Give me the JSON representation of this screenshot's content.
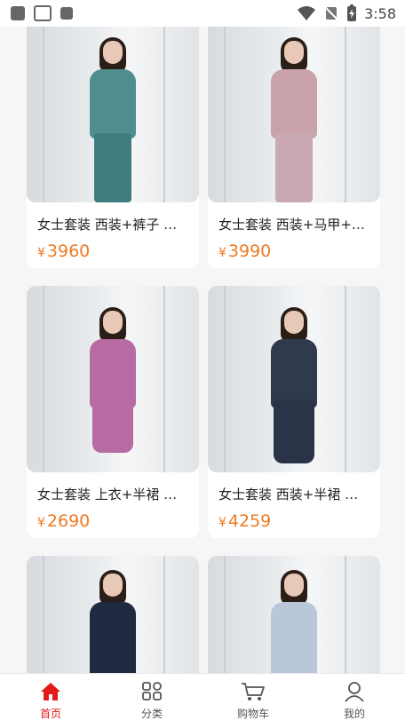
{
  "status_bar": {
    "time": "3:58",
    "icons": [
      "notification-icon",
      "mail-icon",
      "a-icon",
      "wifi-icon",
      "no-sim-icon",
      "battery-charging-icon"
    ]
  },
  "products": [
    {
      "title": "女士套装 西装+裤子 …",
      "currency": "¥",
      "price": "3960",
      "color": "#4f8e8e"
    },
    {
      "title": "女士套装 西装+马甲+…",
      "currency": "¥",
      "price": "3990",
      "color": "#c9a2ab"
    },
    {
      "title": "女士套装 上衣+半裙 …",
      "currency": "¥",
      "price": "2690",
      "color": "#b86aa2"
    },
    {
      "title": "女士套装 西装+半裙 …",
      "currency": "¥",
      "price": "4259",
      "color": "#2f3a4f"
    },
    {
      "title": "",
      "currency": "",
      "price": "",
      "color": "#1f2940"
    },
    {
      "title": "",
      "currency": "",
      "price": "",
      "color": "#b9c7d8"
    }
  ],
  "tabs": [
    {
      "label": "首页",
      "icon": "home-icon",
      "active": true
    },
    {
      "label": "分类",
      "icon": "grid-icon",
      "active": false
    },
    {
      "label": "购物车",
      "icon": "cart-icon",
      "active": false
    },
    {
      "label": "我的",
      "icon": "user-icon",
      "active": false
    }
  ],
  "colors": {
    "accent": "#e11a1a",
    "price": "#ef7a22"
  }
}
